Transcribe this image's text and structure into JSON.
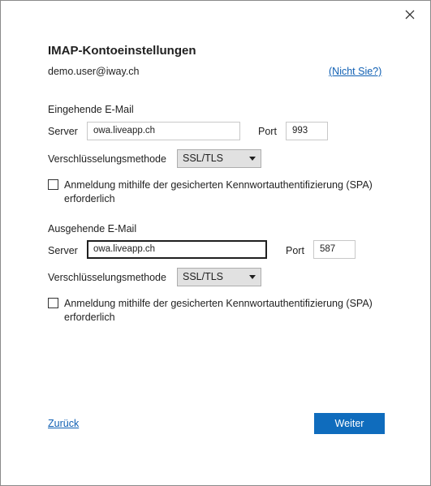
{
  "dialog": {
    "title": "IMAP-Kontoeinstellungen",
    "account": "demo.user@iway.ch",
    "not_you": "(Nicht Sie?)",
    "close_icon": "close-icon"
  },
  "incoming": {
    "heading": "Eingehende E-Mail",
    "server_label": "Server",
    "server_value": "owa.liveapp.ch",
    "port_label": "Port",
    "port_value": "993",
    "encryption_label": "Verschlüsselungsmethode",
    "encryption_value": "SSL/TLS",
    "spa_label": "Anmeldung mithilfe der gesicherten Kennwortauthentifizierung (SPA) erforderlich",
    "spa_checked": false
  },
  "outgoing": {
    "heading": "Ausgehende E-Mail",
    "server_label": "Server",
    "server_value": "owa.liveapp.ch",
    "port_label": "Port",
    "port_value": "587",
    "encryption_label": "Verschlüsselungsmethode",
    "encryption_value": "SSL/TLS",
    "spa_label": "Anmeldung mithilfe der gesicherten Kennwortauthentifizierung (SPA) erforderlich",
    "spa_checked": false
  },
  "footer": {
    "back_label": "Zurück",
    "next_label": "Weiter"
  },
  "colors": {
    "accent": "#0f6cbd",
    "link": "#0f5fb3"
  }
}
